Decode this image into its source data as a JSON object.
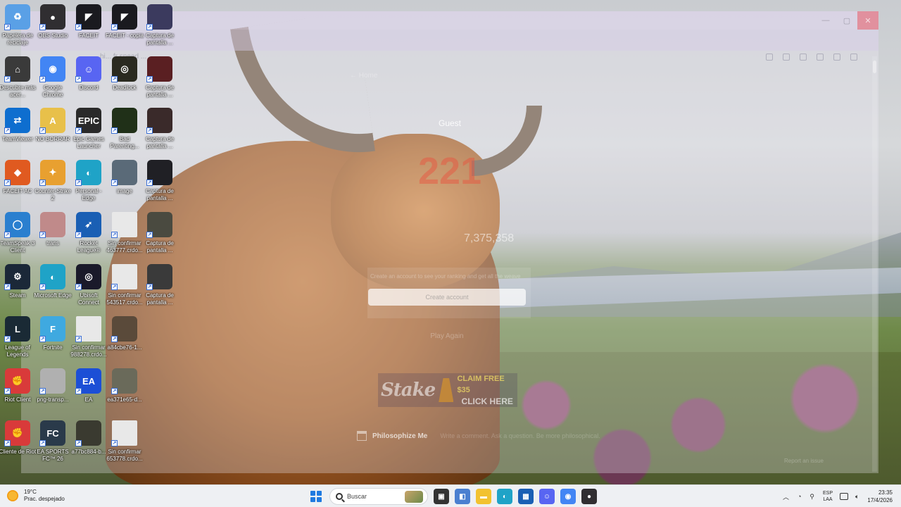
{
  "desktop_icons": [
    {
      "label": "Papelera de reciclaje",
      "icon": "recycle-bin-icon",
      "color": "#5aa0e6",
      "glyph": "♻",
      "col": 0,
      "row": 0
    },
    {
      "label": "OBS Studio",
      "icon": "obs-icon",
      "color": "#302e31",
      "glyph": "●",
      "col": 1,
      "row": 0
    },
    {
      "label": "FACEIT",
      "icon": "faceit-icon",
      "color": "#1a1a1f",
      "glyph": "◤",
      "col": 2,
      "row": 0
    },
    {
      "label": "FACEIT - copia",
      "icon": "faceit-copy-icon",
      "color": "#1a1a1f",
      "glyph": "◤",
      "col": 3,
      "row": 0
    },
    {
      "label": "Captura de pantalla ...",
      "icon": "screenshot-icon",
      "color": "#3b3a5e",
      "glyph": "",
      "col": 4,
      "row": 0
    },
    {
      "label": "Descubre más acer...",
      "icon": "acer-icon",
      "color": "#3a3a3a",
      "glyph": "⌂",
      "col": 0,
      "row": 1
    },
    {
      "label": "Google Chrome",
      "icon": "chrome-icon",
      "color": "#4285f4",
      "glyph": "◉",
      "col": 1,
      "row": 1
    },
    {
      "label": "Discord",
      "icon": "discord-icon",
      "color": "#5865f2",
      "glyph": "☺",
      "col": 2,
      "row": 1
    },
    {
      "label": "Deadlock",
      "icon": "deadlock-icon",
      "color": "#2a2a20",
      "glyph": "◎",
      "col": 3,
      "row": 1
    },
    {
      "label": "Captura de pantalla ...",
      "icon": "screenshot-icon",
      "color": "#5a1f22",
      "glyph": "",
      "col": 4,
      "row": 1
    },
    {
      "label": "TeamViewer",
      "icon": "teamviewer-icon",
      "color": "#0e6ecf",
      "glyph": "⇄",
      "col": 0,
      "row": 2
    },
    {
      "label": "NO BORRAR",
      "icon": "folder-icon",
      "color": "#e8c04a",
      "glyph": "A",
      "col": 1,
      "row": 2
    },
    {
      "label": "Epic Games Launcher",
      "icon": "epic-games-icon",
      "color": "#2a2a2a",
      "glyph": "EPIC",
      "col": 2,
      "row": 2
    },
    {
      "label": "Bad Parenting...",
      "icon": "bad-parenting-icon",
      "color": "#203018",
      "glyph": "",
      "col": 3,
      "row": 2
    },
    {
      "label": "Captura de pantalla ...",
      "icon": "screenshot-icon",
      "color": "#3a2a2a",
      "glyph": "",
      "col": 4,
      "row": 2
    },
    {
      "label": "FACEIT AC",
      "icon": "faceit-ac-icon",
      "color": "#e05a20",
      "glyph": "◆",
      "col": 0,
      "row": 3
    },
    {
      "label": "Counter-Strike 2",
      "icon": "counter-strike-icon",
      "color": "#e8a030",
      "glyph": "✦",
      "col": 1,
      "row": 3
    },
    {
      "label": "Personal - Edge",
      "icon": "edge-icon",
      "color": "#1fa3c7",
      "glyph": "◐",
      "col": 2,
      "row": 3
    },
    {
      "label": "image",
      "icon": "image-file-icon",
      "color": "#5a6a78",
      "glyph": "",
      "col": 3,
      "row": 3
    },
    {
      "label": "Captura de pantalla ...",
      "icon": "screenshot-icon",
      "color": "#202025",
      "glyph": "",
      "col": 4,
      "row": 3
    },
    {
      "label": "TeamSpeak 3 Client",
      "icon": "teamspeak-icon",
      "color": "#2a7fcf",
      "glyph": "◯",
      "col": 0,
      "row": 4
    },
    {
      "label": "trans",
      "icon": "image-file-icon",
      "color": "#c08a8a",
      "glyph": "",
      "col": 1,
      "row": 4
    },
    {
      "label": "Rocket League®",
      "icon": "rocket-league-icon",
      "color": "#1a5fb4",
      "glyph": "➶",
      "col": 2,
      "row": 4
    },
    {
      "label": "Sin confirmar 463777.crdo...",
      "icon": "file-icon",
      "color": "#e8e8e8",
      "glyph": "",
      "col": 3,
      "row": 4
    },
    {
      "label": "Captura de pantalla ...",
      "icon": "screenshot-icon",
      "color": "#4a4a40",
      "glyph": "",
      "col": 4,
      "row": 4
    },
    {
      "label": "Steam",
      "icon": "steam-icon",
      "color": "#1b2838",
      "glyph": "⚙",
      "col": 0,
      "row": 5
    },
    {
      "label": "Microsoft Edge",
      "icon": "edge-icon",
      "color": "#1fa3c7",
      "glyph": "◐",
      "col": 1,
      "row": 5
    },
    {
      "label": "Ubisoft Connect",
      "icon": "ubisoft-icon",
      "color": "#1a1a2a",
      "glyph": "◎",
      "col": 2,
      "row": 5
    },
    {
      "label": "Sin confirmar 543517.crdo...",
      "icon": "file-icon",
      "color": "#e8e8e8",
      "glyph": "",
      "col": 3,
      "row": 5
    },
    {
      "label": "Captura de pantalla ...",
      "icon": "screenshot-icon",
      "color": "#3a3a3a",
      "glyph": "",
      "col": 4,
      "row": 5
    },
    {
      "label": "League of Legends",
      "icon": "league-icon",
      "color": "#1a2a35",
      "glyph": "L",
      "col": 0,
      "row": 6
    },
    {
      "label": "Fortnite",
      "icon": "fortnite-icon",
      "color": "#3fa9e0",
      "glyph": "F",
      "col": 1,
      "row": 6
    },
    {
      "label": "Sin confirmar 988278.crdo...",
      "icon": "file-icon",
      "color": "#e8e8e8",
      "glyph": "",
      "col": 2,
      "row": 6
    },
    {
      "label": "a84cbe76-1...",
      "icon": "image-file-icon",
      "color": "#5a4a3a",
      "glyph": "",
      "col": 3,
      "row": 6
    },
    {
      "label": "Riot Client",
      "icon": "riot-client-icon",
      "color": "#d93a3a",
      "glyph": "✊",
      "col": 0,
      "row": 7
    },
    {
      "label": "png-transp...",
      "icon": "image-file-icon",
      "color": "#b0b0b0",
      "glyph": "",
      "col": 1,
      "row": 7
    },
    {
      "label": "EA",
      "icon": "ea-icon",
      "color": "#1c4fd6",
      "glyph": "EA",
      "col": 2,
      "row": 7
    },
    {
      "label": "ea371e65-d...",
      "icon": "image-file-icon",
      "color": "#6a6a5a",
      "glyph": "",
      "col": 3,
      "row": 7
    },
    {
      "label": "Cliente de Riot",
      "icon": "riot-client-icon",
      "color": "#d93a3a",
      "glyph": "✊",
      "col": 0,
      "row": 8
    },
    {
      "label": "EA SPORTS FC™ 26",
      "icon": "ea-fc-icon",
      "color": "#2a3a4a",
      "glyph": "FC",
      "col": 1,
      "row": 8
    },
    {
      "label": "a77bc884-b...",
      "icon": "image-file-icon",
      "color": "#3a3a30",
      "glyph": "",
      "col": 2,
      "row": 8
    },
    {
      "label": "Sin confirmar 653778.crdo...",
      "icon": "file-icon",
      "color": "#e8e8e8",
      "glyph": "",
      "col": 3,
      "row": 8
    }
  ],
  "app": {
    "tab_label": "hi... fr speed ...",
    "home_link": "← Home",
    "user": "Guest",
    "score": "221",
    "total": "7,375,358",
    "cta_text": "Create an account to see your ranking and get all the weave",
    "create_button": "Create account",
    "play_again": "Play Again",
    "stake": {
      "logo": "Stake",
      "claim": "CLAIM FREE $35",
      "click": "CLICK HERE"
    },
    "footer_brand": "Philosophize Me",
    "footer_sub": "Write a comment. Ask a question. Be more philosophical.",
    "footer_right": "Report an issue"
  },
  "taskbar": {
    "weather_temp": "19°C",
    "weather_desc": "Prac. despejado",
    "search_placeholder": "Buscar",
    "lang_line1": "ESP",
    "lang_line2": "LAA",
    "time": "23:35",
    "date": "17/4/2026",
    "apps": [
      {
        "icon": "task-view-icon",
        "color": "#333333",
        "glyph": "▣"
      },
      {
        "icon": "widgets-icon",
        "color": "#4a7fd0",
        "glyph": "◧"
      },
      {
        "icon": "file-explorer-icon",
        "color": "#f2c230",
        "glyph": "▬"
      },
      {
        "icon": "edge-icon",
        "color": "#1fa3c7",
        "glyph": "◐"
      },
      {
        "icon": "store-icon",
        "color": "#1a5fb4",
        "glyph": "▦"
      },
      {
        "icon": "discord-icon",
        "color": "#5865f2",
        "glyph": "☺"
      },
      {
        "icon": "chrome-icon",
        "color": "#4285f4",
        "glyph": "◉"
      },
      {
        "icon": "obs-icon",
        "color": "#302e31",
        "glyph": "●"
      }
    ]
  }
}
